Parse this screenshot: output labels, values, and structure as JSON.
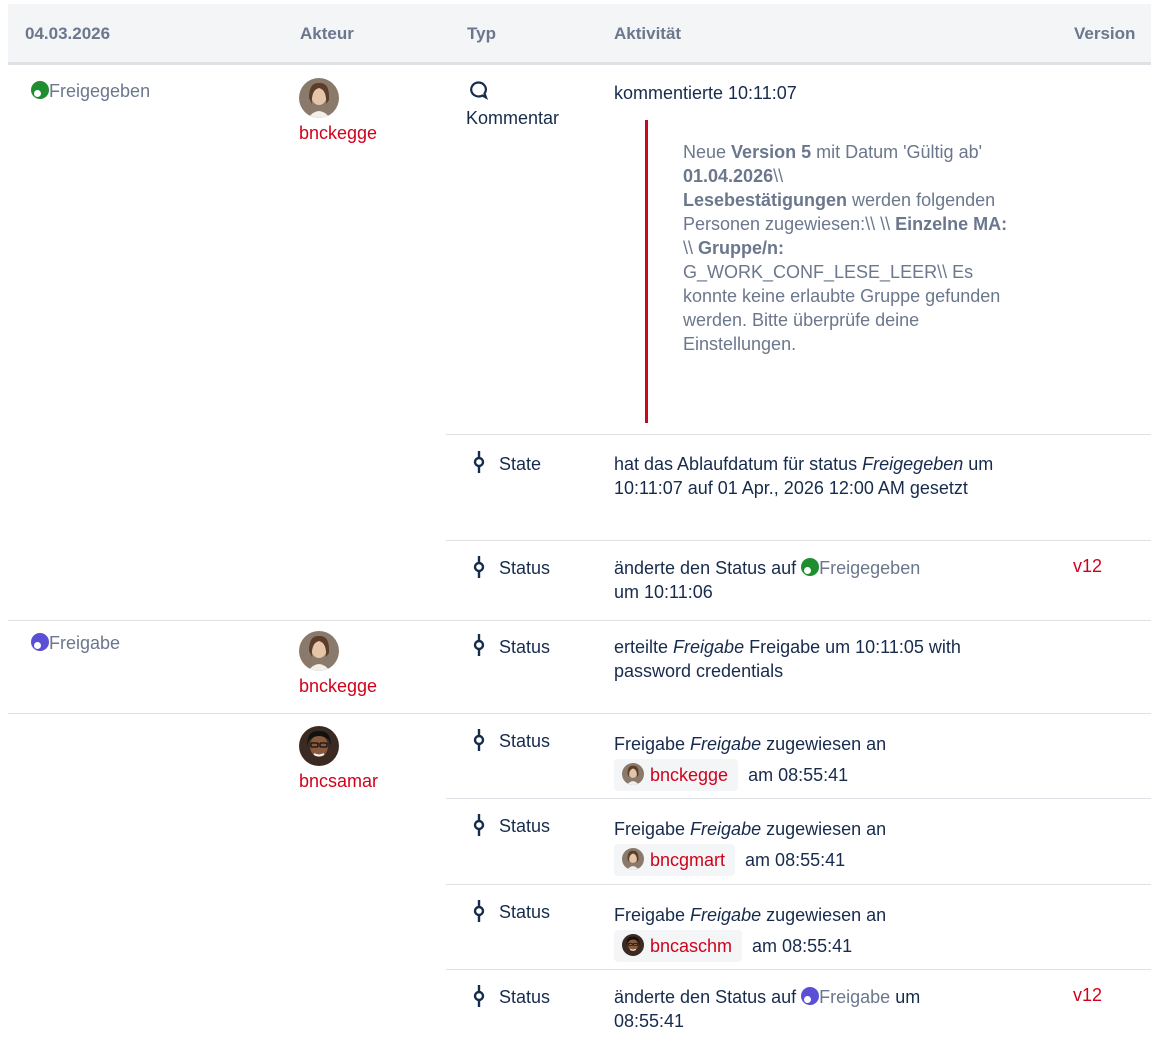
{
  "header": {
    "date": "04.03.2026",
    "actor": "Akteur",
    "type": "Typ",
    "activity": "Aktivität",
    "version": "Version"
  },
  "groups": [
    {
      "lifecycle_state": "Freigegeben",
      "lifecycle_color": "#1e8e2e",
      "actor": "bnckegge",
      "entries": [
        {
          "type": "Kommentar",
          "type_icon": "comment-icon",
          "activity": "kommentierte 10:11:07",
          "comment": {
            "p1_a": "Neue ",
            "p1_b": "Version 5",
            "p1_c": " mit Datum 'Gültig ab' ",
            "p1_d": "01.04.2026",
            "p1_e": "\\\\",
            "p2_a": "Lesebestätigungen",
            "p2_b": " werden folgenden Personen zugewiesen:\\\\ \\\\ ",
            "p2_c": "Einzelne MA:",
            "p2_d": " \\\\ ",
            "p2_e": "Gruppe/n:",
            "p2_f": " G_WORK_CONF_LESE_LEER\\\\ Es konnte keine erlaubte Gruppe gefunden werden. Bitte überprüfe deine Einstellungen."
          }
        },
        {
          "type": "State",
          "type_icon": "commit-icon",
          "activity_a": "hat das Ablaufdatum für status ",
          "activity_em": "Freigegeben",
          "activity_b": " um 10:11:07 auf 01 Apr., 2026 12:00 AM gesetzt"
        },
        {
          "type": "Status",
          "type_icon": "commit-icon",
          "activity_a": "änderte den Status auf ",
          "status": "Freigegeben",
          "activity_b": "um 10:11:06",
          "version": "v12"
        }
      ]
    },
    {
      "lifecycle_state": "Freigabe",
      "lifecycle_color": "#5b4fd6",
      "actor": "bnckegge",
      "entries": [
        {
          "type": "Status",
          "type_icon": "commit-icon",
          "activity_a": "erteilte ",
          "activity_em": "Freigabe",
          "activity_b": " Freigabe um 10:11:05 with password credentials"
        }
      ]
    },
    {
      "lifecycle_state": "",
      "actor": "bncsamar",
      "entries": [
        {
          "type": "Status",
          "type_icon": "commit-icon",
          "activity_a": "Freigabe ",
          "activity_em": "Freigabe",
          "activity_b": " zugewiesen an",
          "assignee": "bnckegge",
          "time": "am 08:55:41"
        },
        {
          "type": "Status",
          "type_icon": "commit-icon",
          "activity_a": "Freigabe ",
          "activity_em": "Freigabe",
          "activity_b": " zugewiesen an",
          "assignee": "bncgmart",
          "time": "am 08:55:41"
        },
        {
          "type": "Status",
          "type_icon": "commit-icon",
          "activity_a": "Freigabe ",
          "activity_em": "Freigabe",
          "activity_b": " zugewiesen an",
          "assignee": "bncaschm",
          "time": "am 08:55:41"
        },
        {
          "type": "Status",
          "type_icon": "commit-icon",
          "activity_a": "änderte den Status auf ",
          "status": "Freigabe",
          "activity_b": " um",
          "activity_c": "08:55:41",
          "version": "v12"
        }
      ]
    }
  ]
}
